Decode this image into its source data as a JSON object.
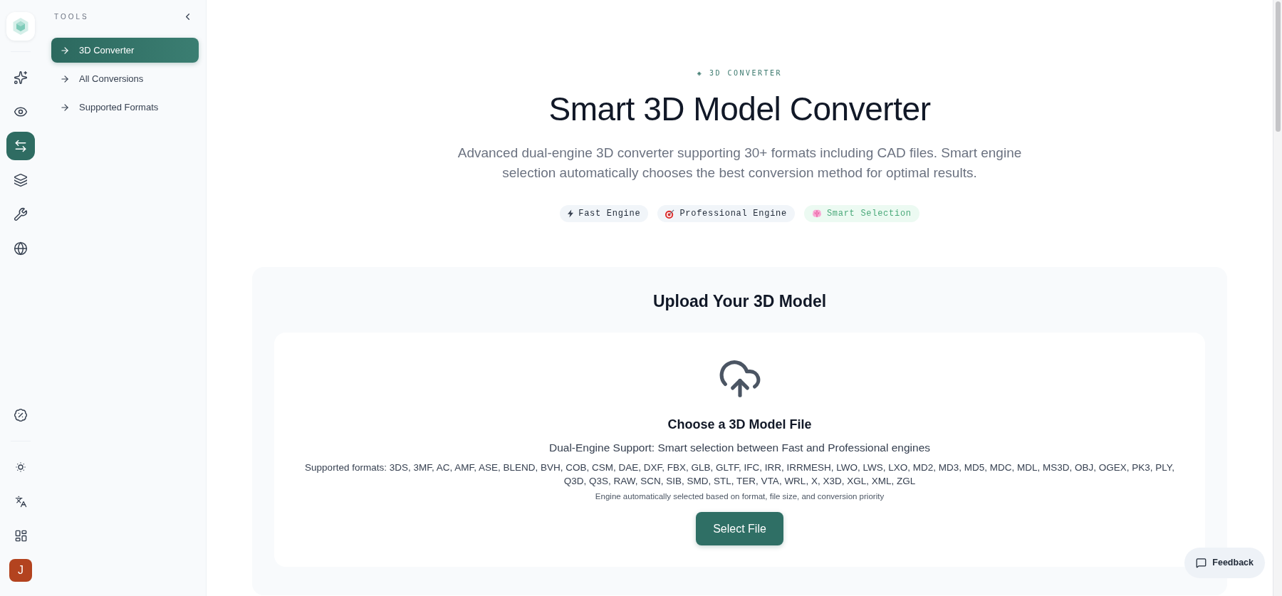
{
  "rail": {
    "items": [
      {
        "kind": "sparkles",
        "selected": false
      },
      {
        "kind": "eye",
        "selected": false
      },
      {
        "kind": "arrows",
        "selected": true
      },
      {
        "kind": "layers",
        "selected": false
      },
      {
        "kind": "wrench",
        "selected": false
      },
      {
        "kind": "globe",
        "selected": false
      }
    ]
  },
  "sidebar": {
    "heading": "TOOLS",
    "items": [
      {
        "label": "3D Converter",
        "selected": true
      },
      {
        "label": "All Conversions",
        "selected": false
      },
      {
        "label": "Supported Formats",
        "selected": false
      }
    ]
  },
  "avatar": {
    "initial": "J"
  },
  "hero": {
    "eyebrow": "◈ 3D CONVERTER",
    "title": "Smart 3D Model Converter",
    "description": "Advanced dual-engine 3D converter supporting 30+ formats including CAD files. Smart engine selection automatically chooses the best conversion method for optimal results.",
    "tags": [
      {
        "kind": "lightning",
        "label": "Fast Engine",
        "highlighted": false
      },
      {
        "kind": "target",
        "label": "Professional Engine",
        "highlighted": false
      },
      {
        "kind": "brain",
        "label": "Smart Selection",
        "highlighted": true
      }
    ]
  },
  "upload": {
    "title": "Upload Your 3D Model",
    "heading": "Choose a 3D Model File",
    "subheading": "Dual-Engine Support: Smart selection between Fast and Professional engines",
    "formats": "Supported formats: 3DS, 3MF, AC, AMF, ASE, BLEND, BVH, COB, CSM, DAE, DXF, FBX, GLB, GLTF, IFC, IRR, IRRMESH, LWO, LWS, LXO, MD2, MD3, MD5, MDC, MDL, MS3D, OBJ, OGEX, PK3, PLY, Q3D, Q3S, RAW, SCN, SIB, SMD, STL, TER, VTA, WRL, X, X3D, XGL, XML, ZGL",
    "note": "Engine automatically selected based on format, file size, and conversion priority",
    "button": "Select File"
  },
  "feedback_button": "Feedback"
}
